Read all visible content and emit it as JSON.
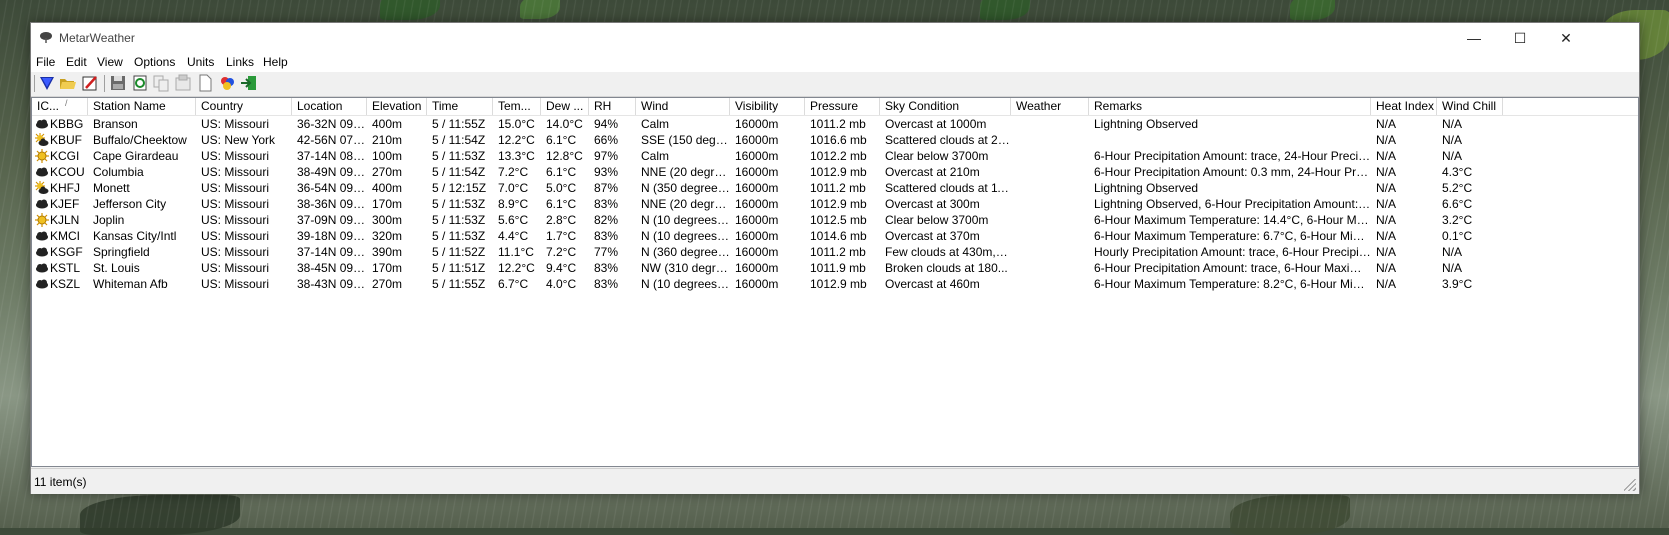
{
  "window": {
    "title": "MetarWeather"
  },
  "window_controls": {
    "minimize": "—",
    "maximize": "☐",
    "close": "✕"
  },
  "menu": [
    "File",
    "Edit",
    "View",
    "Options",
    "Units",
    "Links",
    "Help"
  ],
  "toolbar": {
    "buttons": [
      "filter-icon",
      "open-folder-icon",
      "edit-icon",
      "save-icon",
      "refresh-icon",
      "copy-icon",
      "properties-icon",
      "new-document-icon",
      "colors-icon",
      "exit-icon"
    ]
  },
  "columns": [
    "IC...",
    "Station Name",
    "Country",
    "Location",
    "Elevation",
    "Time",
    "Tem...",
    "Dew ...",
    "RH",
    "Wind",
    "Visibility",
    "Pressure",
    "Sky Condition",
    "Weather",
    "Remarks",
    "Heat Index",
    "Wind Chill"
  ],
  "sort": {
    "column": 0,
    "direction": "ascending",
    "glyph": "/"
  },
  "rows": [
    {
      "icon": "cloud",
      "cells": [
        "KBBG",
        "Branson",
        "US: Missouri",
        "36-32N 093...",
        "400m",
        "5 / 11:55Z",
        "15.0°C",
        "14.0°C",
        "94%",
        "Calm",
        "16000m",
        "1011.2 mb",
        "Overcast at 1000m",
        "",
        "Lightning Observed",
        "N/A",
        "N/A"
      ]
    },
    {
      "icon": "sun-cloud",
      "cells": [
        "KBUF",
        "Buffalo/Cheektow",
        "US: New York",
        "42-56N 078...",
        "210m",
        "5 / 11:54Z",
        "12.2°C",
        "6.1°C",
        "66%",
        "SSE (150 degrees...",
        "16000m",
        "1016.6 mb",
        "Scattered clouds at 24...",
        "",
        "",
        "N/A",
        "N/A"
      ]
    },
    {
      "icon": "sun",
      "cells": [
        "KCGI",
        "Cape Girardeau",
        "US: Missouri",
        "37-14N 089...",
        "100m",
        "5 / 11:53Z",
        "13.3°C",
        "12.8°C",
        "97%",
        "Calm",
        "16000m",
        "1012.2 mb",
        "Clear below 3700m",
        "",
        "6-Hour Precipitation Amount: trace, 24-Hour Precipi...",
        "N/A",
        "N/A"
      ]
    },
    {
      "icon": "cloud",
      "cells": [
        "KCOU",
        "Columbia",
        "US: Missouri",
        "38-49N 092...",
        "270m",
        "5 / 11:54Z",
        "7.2°C",
        "6.1°C",
        "93%",
        "NNE (20 degree...",
        "16000m",
        "1012.9 mb",
        "Overcast at 210m",
        "",
        "6-Hour Precipitation Amount: 0.3 mm, 24-Hour Prec...",
        "N/A",
        "4.3°C"
      ]
    },
    {
      "icon": "sun-cloud",
      "cells": [
        "KHFJ",
        "Monett",
        "US: Missouri",
        "36-54N 094...",
        "400m",
        "5 / 12:15Z",
        "7.0°C",
        "5.0°C",
        "87%",
        "N (350 degrees...",
        "16000m",
        "1011.2 mb",
        "Scattered clouds at 11...",
        "",
        "Lightning Observed",
        "N/A",
        "5.2°C"
      ]
    },
    {
      "icon": "cloud",
      "cells": [
        "KJEF",
        "Jefferson City",
        "US: Missouri",
        "38-36N 092...",
        "170m",
        "5 / 11:53Z",
        "8.9°C",
        "6.1°C",
        "83%",
        "NNE (20 degree...",
        "16000m",
        "1012.9 mb",
        "Overcast at 300m",
        "",
        "Lightning Observed, 6-Hour Precipitation Amount: 6...",
        "N/A",
        "6.6°C"
      ]
    },
    {
      "icon": "sun",
      "cells": [
        "KJLN",
        "Joplin",
        "US: Missouri",
        "37-09N 094...",
        "300m",
        "5 / 11:53Z",
        "5.6°C",
        "2.8°C",
        "82%",
        "N (10 degrees) ...",
        "16000m",
        "1012.5 mb",
        "Clear below 3700m",
        "",
        "6-Hour Maximum Temperature: 14.4°C, 6-Hour Mini...",
        "N/A",
        "3.2°C"
      ]
    },
    {
      "icon": "cloud",
      "cells": [
        "KMCI",
        "Kansas City/Intl",
        "US: Missouri",
        "39-18N 094...",
        "320m",
        "5 / 11:53Z",
        "4.4°C",
        "1.7°C",
        "83%",
        "N (10 degrees) ...",
        "16000m",
        "1014.6 mb",
        "Overcast at 370m",
        "",
        "6-Hour Maximum Temperature: 6.7°C, 6-Hour Mini...",
        "N/A",
        "0.1°C"
      ]
    },
    {
      "icon": "cloud",
      "cells": [
        "KSGF",
        "Springfield",
        "US: Missouri",
        "37-14N 093...",
        "390m",
        "5 / 11:52Z",
        "11.1°C",
        "7.2°C",
        "77%",
        "N (360 degrees...",
        "16000m",
        "1011.2 mb",
        "Few clouds at 430m, O...",
        "",
        "Hourly Precipitation Amount: trace, 6-Hour Precipita...",
        "N/A",
        "N/A"
      ]
    },
    {
      "icon": "cloud",
      "cells": [
        "KSTL",
        "St. Louis",
        "US: Missouri",
        "38-45N 090...",
        "170m",
        "5 / 11:51Z",
        "12.2°C",
        "9.4°C",
        "83%",
        "NW (310 degree...",
        "16000m",
        "1011.9 mb",
        "Broken clouds at 180...",
        "",
        "6-Hour Precipitation Amount: trace, 6-Hour Maximu...",
        "N/A",
        "N/A"
      ]
    },
    {
      "icon": "cloud",
      "cells": [
        "KSZL",
        "Whiteman Afb",
        "US: Missouri",
        "38-43N 093...",
        "270m",
        "5 / 11:55Z",
        "6.7°C",
        "4.0°C",
        "83%",
        "N (10 degrees) ...",
        "16000m",
        "1012.9 mb",
        "Overcast at 460m",
        "",
        "6-Hour Maximum Temperature: 8.2°C, 6-Hour Mini...",
        "N/A",
        "3.9°C"
      ]
    }
  ],
  "status": {
    "text": "11 item(s)"
  }
}
